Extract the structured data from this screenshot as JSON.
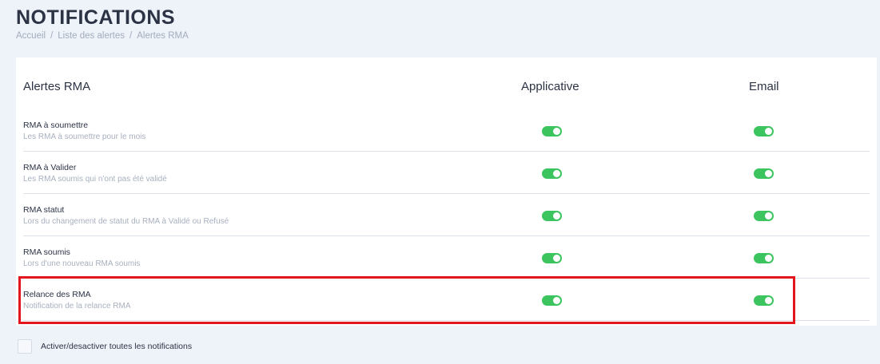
{
  "header": {
    "title": "NOTIFICATIONS",
    "breadcrumb": [
      "Accueil",
      "Liste des alertes",
      "Alertes RMA"
    ],
    "breadcrumb_separator": "/"
  },
  "table": {
    "columns": {
      "name": "Alertes RMA",
      "applicative": "Applicative",
      "email": "Email"
    },
    "rows": [
      {
        "title": "RMA à soumettre",
        "subtitle": "Les RMA à soumettre pour le mois",
        "applicative": true,
        "email": true
      },
      {
        "title": "RMA à Valider",
        "subtitle": "Les RMA soumis qui n'ont pas été validé",
        "applicative": true,
        "email": true
      },
      {
        "title": "RMA statut",
        "subtitle": "Lors du changement de statut du RMA à Validé ou Refusé",
        "applicative": true,
        "email": true
      },
      {
        "title": "RMA soumis",
        "subtitle": "Lors d'une nouveau RMA soumis",
        "applicative": true,
        "email": true
      },
      {
        "title": "Relance des RMA",
        "subtitle": "Notification de la relance RMA",
        "applicative": true,
        "email": true
      }
    ]
  },
  "footer": {
    "toggle_all_label": "Activer/desactiver toutes les notifications",
    "toggle_all_checked": false
  },
  "colors": {
    "toggle_on": "#3cc45f",
    "highlight_border": "#e3161f",
    "page_background": "#eef2f9"
  }
}
